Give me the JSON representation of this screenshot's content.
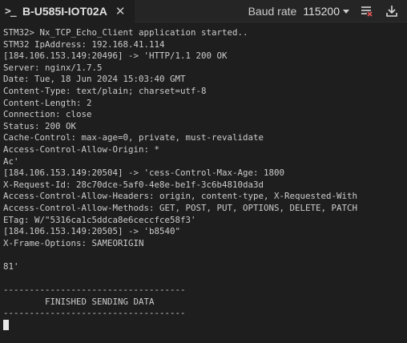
{
  "tab": {
    "icon": "terminal-icon",
    "title": "B-U585I-IOT02A",
    "close_label": "✕"
  },
  "toolbar": {
    "baud_label": "Baud rate",
    "baud_value": "115200",
    "clear_icon": "clear-log-icon",
    "download_icon": "download-icon",
    "clear_icon_color": "#e05252"
  },
  "console": {
    "lines": [
      "STM32> Nx_TCP_Echo_Client application started..",
      "STM32 IpAddress: 192.168.41.114",
      "[184.106.153.149:20496] -> 'HTTP/1.1 200 OK",
      "Server: nginx/1.7.5",
      "Date: Tue, 18 Jun 2024 15:03:40 GMT",
      "Content-Type: text/plain; charset=utf-8",
      "Content-Length: 2",
      "Connection: close",
      "Status: 200 OK",
      "Cache-Control: max-age=0, private, must-revalidate",
      "Access-Control-Allow-Origin: *",
      "Ac'",
      "[184.106.153.149:20504] -> 'cess-Control-Max-Age: 1800",
      "X-Request-Id: 28c70dce-5af0-4e8e-be1f-3c6b4810da3d",
      "Access-Control-Allow-Headers: origin, content-type, X-Requested-With",
      "Access-Control-Allow-Methods: GET, POST, PUT, OPTIONS, DELETE, PATCH",
      "ETag: W/\"5316ca1c5ddca8e6ceccfce58f3'",
      "[184.106.153.149:20505] -> 'b8540\"",
      "X-Frame-Options: SAMEORIGIN",
      "",
      "81'",
      "",
      "-----------------------------------",
      "        FINISHED SENDING DATA",
      "-----------------------------------"
    ]
  }
}
